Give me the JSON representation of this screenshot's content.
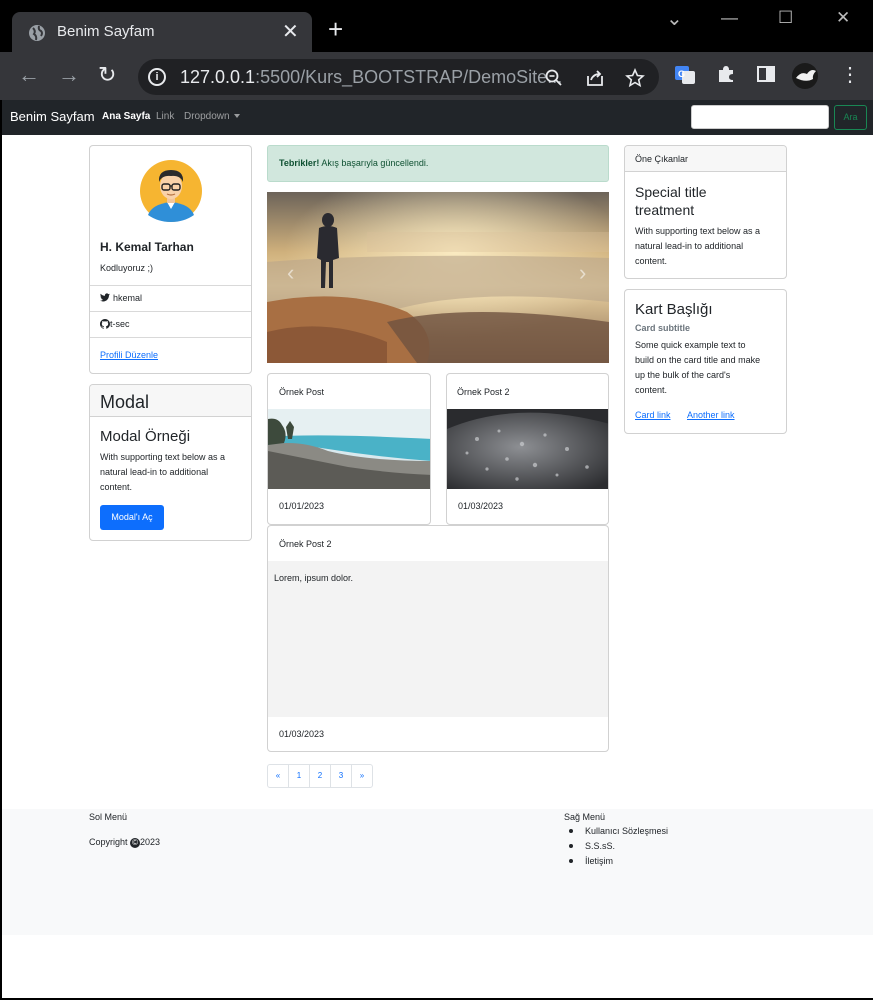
{
  "browser": {
    "tab_title": "Benim Sayfam",
    "tab_close": "✕",
    "new_tab": "+",
    "url_host": "127.0.0.1",
    "url_rest": ":5500/Kurs_BOOTSTRAP/DemoSite...",
    "window_controls": {
      "minimize": "—",
      "maximize": "☐",
      "close": "✕",
      "tabsearch": "⌄"
    },
    "nav": {
      "back": "←",
      "forward": "→",
      "reload": "↻"
    }
  },
  "navbar": {
    "brand": "Benim Sayfam",
    "links": [
      "Ana Sayfa",
      "Link",
      "Dropdown"
    ],
    "search_placeholder": "",
    "search_button": "Ara"
  },
  "profile": {
    "name": "H. Kemal Tarhan",
    "tagline": "Kodluyoruz ;)",
    "twitter": "hkemal",
    "github": "t-sec",
    "edit_link": "Profili Düzenle"
  },
  "modal_card": {
    "header": "Modal",
    "title": "Modal Örneği",
    "text": [
      "With supporting text below as a",
      "natural lead-in to additional",
      "content."
    ],
    "button": "Modal'ı Aç"
  },
  "alert": {
    "strong": "Tebrikler!",
    "text": " Akış başarıyla güncellendi."
  },
  "carousel": {
    "prev": "‹",
    "next": "›"
  },
  "posts": [
    {
      "title": "Örnek Post",
      "date": "01/01/2023"
    },
    {
      "title": "Örnek Post 2",
      "date": "01/03/2023"
    },
    {
      "title": "Örnek Post 2",
      "body": "Lorem, ipsum dolor.",
      "date": "01/03/2023"
    }
  ],
  "pagination": [
    "«",
    "1",
    "2",
    "3",
    "»"
  ],
  "featured": {
    "header": "Öne Çıkanlar",
    "title": [
      "Special title",
      "treatment"
    ],
    "text": [
      "With supporting text below as a",
      "natural lead-in to additional",
      "content."
    ]
  },
  "card2": {
    "title": "Kart Başlığı",
    "subtitle": "Card subtitle",
    "text": [
      "Some quick example text to",
      "build on the card title and make",
      "up the bulk of the card's",
      "content."
    ],
    "link1": "Card link",
    "link2": "Another link"
  },
  "footer": {
    "left_title": "Sol Menü",
    "copyright_pre": "Copyright ",
    "copyright_symbol": "©",
    "copyright_year": "2023",
    "right_title": "Sağ Menü",
    "right_items": [
      "Kullanıcı Sözleşmesi",
      "S.S.sS.",
      "İletişim"
    ]
  }
}
